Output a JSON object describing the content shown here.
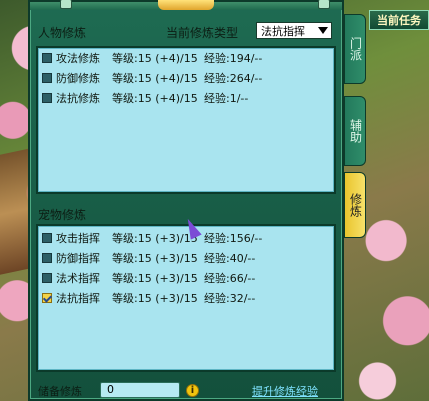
{
  "quest_tab": "当前任务",
  "person_section": {
    "title": "人物修炼",
    "type_label": "当前修炼类型",
    "type_select": "法抗指挥",
    "rows": [
      {
        "name": "攻法修炼",
        "level": "等级:15 (+4)/15",
        "exp": "经验:194/--",
        "checked": false
      },
      {
        "name": "防御修炼",
        "level": "等级:15 (+4)/15",
        "exp": "经验:264/--",
        "checked": false
      },
      {
        "name": "法抗修炼",
        "level": "等级:15 (+4)/15",
        "exp": "经验:1/--",
        "checked": false
      }
    ]
  },
  "pet_section": {
    "title": "宠物修炼",
    "rows": [
      {
        "name": "攻击指挥",
        "level": "等级:15 (+3)/15",
        "exp": "经验:156/--",
        "checked": false
      },
      {
        "name": "防御指挥",
        "level": "等级:15 (+3)/15",
        "exp": "经验:40/--",
        "checked": false
      },
      {
        "name": "法术指挥",
        "level": "等级:15 (+3)/15",
        "exp": "经验:66/--",
        "checked": false
      },
      {
        "name": "法抗指挥",
        "level": "等级:15 (+3)/15",
        "exp": "经验:32/--",
        "checked": true
      }
    ]
  },
  "bottom": {
    "reserve_label": "储备修炼",
    "reserve_value": "0",
    "upgrade_link": "提升修炼经验"
  },
  "side_tabs": [
    "门派",
    "辅助",
    "修炼"
  ],
  "colors": {
    "panel": "#a9e4ef",
    "window": "#1e6b52",
    "active_tab": "#f7e16a",
    "link": "#7fe3ff"
  }
}
